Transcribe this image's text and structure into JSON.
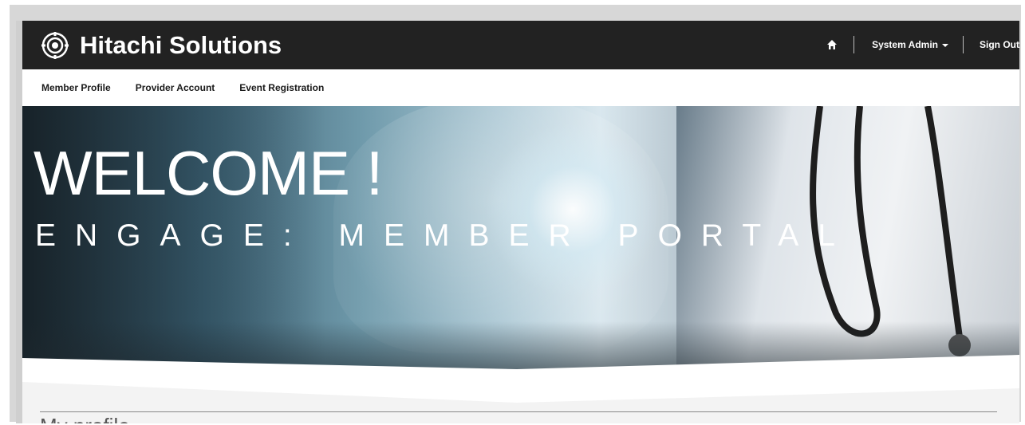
{
  "header": {
    "brand_name": "Hitachi Solutions",
    "home_icon": "home-icon",
    "user_menu_label": "System Admin",
    "sign_out_label": "Sign Out"
  },
  "subnav": {
    "items": [
      {
        "label": "Member Profile"
      },
      {
        "label": "Provider Account"
      },
      {
        "label": "Event Registration"
      }
    ]
  },
  "hero": {
    "title": "WELCOME !",
    "subtitle": "ENGAGE: MEMBER PORTAL"
  },
  "main": {
    "section_title": "My profile"
  },
  "colors": {
    "header_bg": "#222222",
    "nav_text": "#1a1a1a"
  }
}
